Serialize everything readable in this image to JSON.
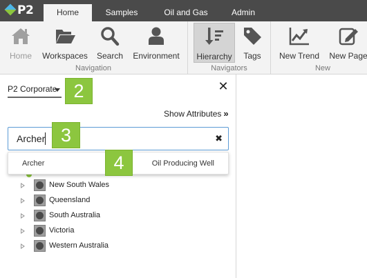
{
  "app": {
    "logo_text": "P2"
  },
  "tabs": [
    {
      "label": "Home",
      "active": true
    },
    {
      "label": "Samples",
      "active": false
    },
    {
      "label": "Oil and Gas",
      "active": false
    },
    {
      "label": "Admin",
      "active": false
    }
  ],
  "ribbon": {
    "navigation": {
      "group_label": "Navigation",
      "home": "Home",
      "workspaces": "Workspaces",
      "search": "Search",
      "environment": "Environment"
    },
    "navigators": {
      "group_label": "Navigators",
      "hierarchy": "Hierarchy",
      "tags": "Tags"
    },
    "new": {
      "group_label": "New",
      "new_trend": "New Trend",
      "new_page": "New Page"
    }
  },
  "panel": {
    "model_select": "P2 Corporate",
    "show_attributes": "Show Attributes",
    "search": {
      "value": "Archer"
    },
    "suggestion": {
      "name": "Archer",
      "type": "Oil Producing Well"
    },
    "tree": [
      {
        "label": "New South Wales"
      },
      {
        "label": "Queensland"
      },
      {
        "label": "South Australia"
      },
      {
        "label": "Victoria"
      },
      {
        "label": "Western Australia"
      }
    ]
  },
  "callouts": {
    "two": "2",
    "three": "3",
    "four": "4"
  },
  "colors": {
    "accent_green": "#8cc63f",
    "tab_bar": "#4a4a4a",
    "ribbon": "#f3f3f3",
    "focus_blue": "#5b9bd5"
  }
}
